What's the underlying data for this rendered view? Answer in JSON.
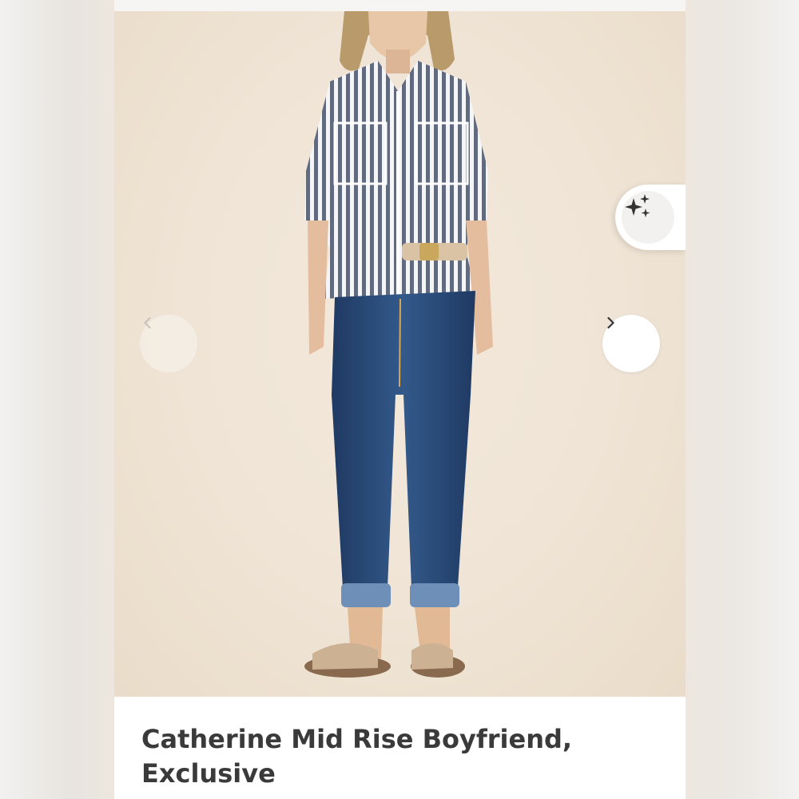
{
  "product": {
    "title": "Catherine Mid Rise Boyfriend, Exclusive"
  },
  "gallery": {
    "prev_icon": "chevron-left-icon",
    "next_icon": "chevron-right-icon",
    "ai_icon": "sparkles-icon"
  },
  "colors": {
    "background": "#efe4d5",
    "title_text": "#3a3a3a",
    "icon": "#333333"
  }
}
